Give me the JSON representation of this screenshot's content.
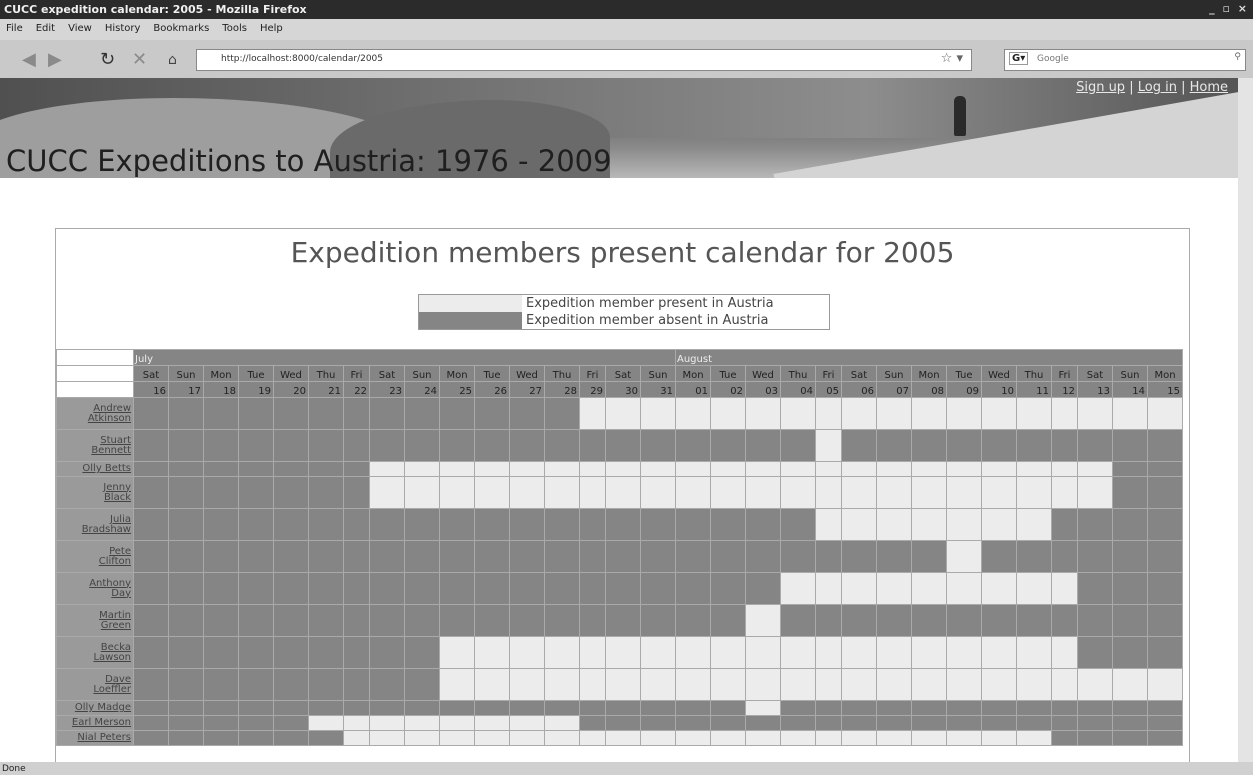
{
  "browser": {
    "title": "CUCC expedition calendar: 2005 - Mozilla Firefox",
    "menu": [
      "File",
      "Edit",
      "View",
      "History",
      "Bookmarks",
      "Tools",
      "Help"
    ],
    "url": "http://localhost:8000/calendar/2005",
    "search_placeholder": "Google",
    "status": "Done",
    "window_buttons": "_ ▫ ×"
  },
  "site": {
    "title": "CUCC Expeditions to Austria: 1976 - 2009",
    "links": [
      "Sign up",
      "Log in",
      "Home"
    ],
    "sep": "|"
  },
  "calendar": {
    "title": "Expedition members present calendar for 2005",
    "legend": [
      {
        "label": "Expedition member present in Austria",
        "color": "#ececec"
      },
      {
        "label": "Expedition member absent in Austria",
        "color": "#858585"
      }
    ],
    "months": [
      "July",
      "August"
    ],
    "weekdays": [
      "Sat",
      "Sun",
      "Mon",
      "Tue",
      "Wed",
      "Thu",
      "Fri",
      "Sat",
      "Sun",
      "Mon",
      "Tue",
      "Wed",
      "Thu",
      "Fri",
      "Sat",
      "Sun",
      "Mon",
      "Tue",
      "Wed",
      "Thu",
      "Fri",
      "Sat",
      "Sun",
      "Mon",
      "Tue",
      "Wed",
      "Thu",
      "Fri",
      "Sat",
      "Sun",
      "Mon"
    ],
    "days": [
      "16",
      "17",
      "18",
      "19",
      "20",
      "21",
      "22",
      "23",
      "24",
      "25",
      "26",
      "27",
      "28",
      "29",
      "30",
      "31",
      "01",
      "02",
      "03",
      "04",
      "05",
      "06",
      "07",
      "08",
      "09",
      "10",
      "11",
      "12",
      "13",
      "14",
      "15"
    ],
    "members": [
      {
        "name": [
          "Andrew",
          "Atkinson"
        ],
        "present": "0000000000000111111111111111111"
      },
      {
        "name": [
          "Stuart",
          "Bennett"
        ],
        "present": "0000000000000000000010000000000"
      },
      {
        "name": [
          "Olly Betts"
        ],
        "present": "0000000111111111111111111111100"
      },
      {
        "name": [
          "Jenny",
          "Black"
        ],
        "present": "0000000111111111111111111111100"
      },
      {
        "name": [
          "Julia",
          "Bradshaw"
        ],
        "present": "0000000000000000000011111110000"
      },
      {
        "name": [
          "Pete",
          "Clifton"
        ],
        "present": "0000000000000000000000001000000"
      },
      {
        "name": [
          "Anthony",
          "Day"
        ],
        "present": "0000000000000000000111111111000"
      },
      {
        "name": [
          "Martin",
          "Green"
        ],
        "present": "0000000000000000001000000000000"
      },
      {
        "name": [
          "Becka",
          "Lawson"
        ],
        "present": "0000000001111111111111111111000"
      },
      {
        "name": [
          "Dave",
          "Loeffler"
        ],
        "present": "0000000001111111111111111111111"
      },
      {
        "name": [
          "Olly Madge"
        ],
        "present": "0000000000000000001000000000000"
      },
      {
        "name": [
          "Earl Merson"
        ],
        "present": "0000011111111000000000000000000"
      },
      {
        "name": [
          "Nial Peters"
        ],
        "present": "0000001111111111111111111110000"
      }
    ]
  }
}
